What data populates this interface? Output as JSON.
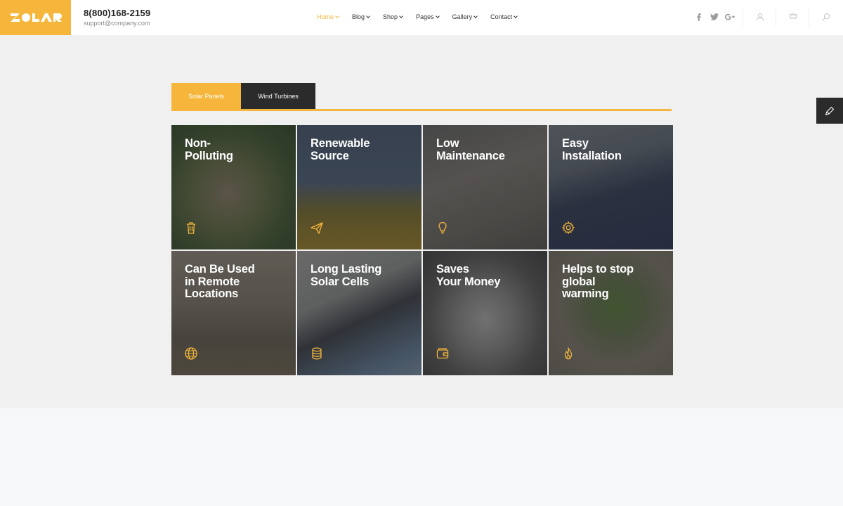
{
  "header": {
    "logo_text": "SOLAR",
    "phone": "8(800)168-2159",
    "email": "support@company.com",
    "nav": [
      {
        "label": "Home",
        "active": true
      },
      {
        "label": "Blog",
        "active": false
      },
      {
        "label": "Shop",
        "active": false
      },
      {
        "label": "Pages",
        "active": false
      },
      {
        "label": "Gallery",
        "active": false
      },
      {
        "label": "Contact",
        "active": false
      }
    ],
    "social_icons": [
      "facebook-icon",
      "twitter-icon",
      "google-plus-icon"
    ],
    "util_icons": [
      "user-icon",
      "cart-icon",
      "search-icon"
    ]
  },
  "tabs": [
    {
      "label": "Solar Panels",
      "active": true
    },
    {
      "label": "Wind Turbines",
      "active": false
    }
  ],
  "tiles": [
    {
      "title": "Non-\nPolluting",
      "icon": "trash-icon"
    },
    {
      "title": "Renewable\nSource",
      "icon": "paper-plane-icon"
    },
    {
      "title": "Low\nMaintenance",
      "icon": "lightbulb-icon"
    },
    {
      "title": "Easy\nInstallation",
      "icon": "gear-icon"
    },
    {
      "title": "Can Be Used\nin Remote\nLocations",
      "icon": "globe-icon"
    },
    {
      "title": "Long Lasting\nSolar Cells",
      "icon": "database-icon"
    },
    {
      "title": "Saves\nYour Money",
      "icon": "wallet-icon"
    },
    {
      "title": "Helps to stop\nglobal\nwarming",
      "icon": "flame-icon"
    }
  ],
  "colors": {
    "accent": "#f6b63b",
    "dark": "#2b2b2b",
    "background": "#f0f0f1"
  }
}
